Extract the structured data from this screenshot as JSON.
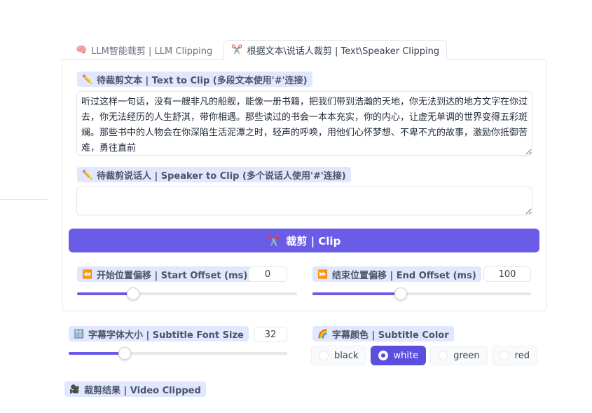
{
  "tabs": [
    {
      "icon": "🧠",
      "label": "LLM智能裁剪 | LLM Clipping"
    },
    {
      "icon": "✂️",
      "label": "根据文本\\说话人裁剪 | Text\\Speaker Clipping"
    }
  ],
  "text_to_clip": {
    "icon": "✏️",
    "label": "待裁剪文本 | Text to Clip (多段文本使用'#'连接)",
    "value": "听过这样一句话，没有一艘非凡的船舰，能像一册书籍，把我们带到浩瀚的天地，你无法到达的地方文字在你过去，你无法经历的人生舒淇，带你相遇。那些读过的书会一本本充实，你的内心，让虚无单调的世界变得五彩斑斓。那些书中的人物会在你深陷生活泥潭之时，轻声的呼唤，用他们心怀梦想、不卑不亢的故事，激励你抵御苦难，勇往直前"
  },
  "speaker_to_clip": {
    "icon": "✏️",
    "label": "待裁剪说话人 | Speaker to Clip (多个说话人使用'#'连接)",
    "value": ""
  },
  "clip_button": {
    "icon": "✂️",
    "label": "裁剪 | Clip"
  },
  "start_offset": {
    "icon": "⏪",
    "label": "开始位置偏移 | Start Offset (ms)",
    "value": "0",
    "fraction": 0.255
  },
  "end_offset": {
    "icon": "⏩",
    "label": "结束位置偏移 | End Offset (ms)",
    "value": "100",
    "fraction": 0.405
  },
  "font_size": {
    "icon": "🔠",
    "label": "字幕字体大小 | Subtitle Font Size",
    "value": "32",
    "fraction": 0.255
  },
  "subtitle_color": {
    "icon": "🌈",
    "label": "字幕颜色 | Subtitle Color",
    "options": [
      "black",
      "white",
      "green",
      "red"
    ],
    "selected": "white"
  },
  "video_clipped": {
    "icon": "🎥",
    "label": "裁剪结果 | Video Clipped"
  },
  "colors": {
    "accent": "#6b5ce7",
    "chip_bg": "#e0e7ff"
  }
}
